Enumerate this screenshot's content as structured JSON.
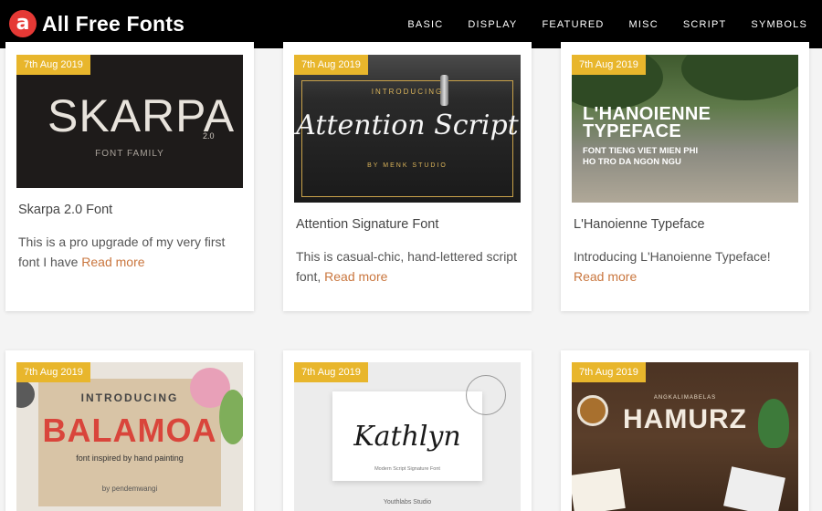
{
  "site": {
    "logo_letter": "a",
    "name": "All Free Fonts",
    "nav": [
      "BASIC",
      "DISPLAY",
      "FEATURED",
      "MISC",
      "SCRIPT",
      "SYMBOLS"
    ]
  },
  "colors": {
    "header_bg": "#000000",
    "date_badge": "#e8b62c",
    "read_more": "#c9763e",
    "logo_red": "#e53935"
  },
  "read_more_label": "Read more",
  "posts": [
    {
      "date": "7th Aug 2019",
      "title": "Skarpa 2.0 Font",
      "excerpt": "This is a pro upgrade of my very first font I have",
      "image": {
        "main": "SKARPA",
        "version": "2.0",
        "sub": "FONT FAMILY"
      }
    },
    {
      "date": "7th Aug 2019",
      "title": "Attention Signature Font",
      "excerpt": "This is casual-chic, hand-lettered script font,",
      "image": {
        "intro": "INTRODUCING",
        "main": "Attention Script",
        "sub": "BY MENK STUDIO"
      }
    },
    {
      "date": "7th Aug 2019",
      "title": "L'Hanoienne Typeface",
      "excerpt": "Introducing L'Hanoienne Typeface!",
      "image": {
        "main_line1": "L'HANOIENNE",
        "main_line2": "TYPEFACE",
        "sub_line1": "FONT TIENG VIET MIEN PHI",
        "sub_line2": "HO TRO DA NGON NGU"
      }
    },
    {
      "date": "7th Aug 2019",
      "image": {
        "intro": "INTRODUCING",
        "main": "BALAMOA",
        "sub": "font inspired by hand painting",
        "author": "by pendemwangi"
      }
    },
    {
      "date": "7th Aug 2019",
      "image": {
        "main": "Kathlyn",
        "sub": "Modern Script Signature Font",
        "studio": "Youthlabs Studio"
      }
    },
    {
      "date": "7th Aug 2019",
      "image": {
        "top": "ANGKALIMABELAS",
        "main": "HAMURZ"
      }
    }
  ]
}
